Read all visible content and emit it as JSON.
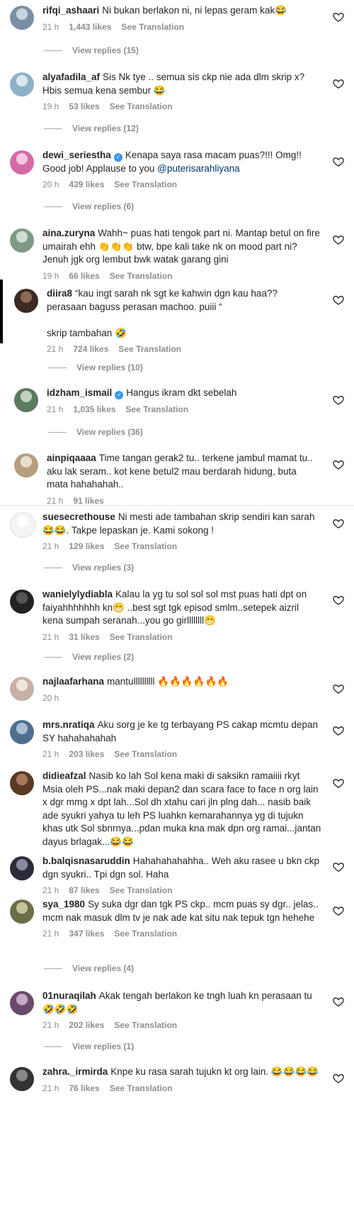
{
  "labels": {
    "see_translation": "See Translation"
  },
  "comments": [
    {
      "user": "rifqi_ashaari",
      "verified": false,
      "text": "Ni bukan berlakon ni, ni lepas geram kak😂",
      "time": "21 h",
      "likes": "1,443 likes",
      "translate": true,
      "replies": "View replies (15)",
      "avatar": [
        "#7a8fa6",
        "#c9d4de"
      ]
    },
    {
      "user": "alyafadila_af",
      "verified": false,
      "text": "Sis Nk tye .. semua sis ckp nie ada dlm skrip x? Hbis semua kena sembur 😂",
      "time": "19 h",
      "likes": "53 likes",
      "translate": true,
      "replies": "View replies (12)",
      "avatar": [
        "#8fb1c7",
        "#dbe6ee"
      ]
    },
    {
      "user": "dewi_seriestha",
      "verified": true,
      "text": "Kenapa saya rasa macam puas?!!! Omg!! Good job! Applause to you ",
      "mention": "@puterisarahliyana",
      "time": "20 h",
      "likes": "439 likes",
      "translate": true,
      "replies": "View replies (6)",
      "avatar": [
        "#d46aa6",
        "#f1c7df"
      ]
    },
    {
      "user": "aina.zuryna",
      "verified": false,
      "text": "Wahh~ puas hati tengok part ni. Mantap betul on fire umairah ehh 👏👏👏 btw, bpe kali take nk on mood part ni? Jenuh jgk org lembut bwk watak garang gini",
      "time": "19 h",
      "likes": "66 likes",
      "translate": true,
      "replies": "",
      "avatar": [
        "#7d9a86",
        "#cfdcd3"
      ]
    },
    {
      "user": "diira8",
      "verified": false,
      "text": "“kau ingt sarah nk sgt ke kahwin dgn kau haa?? perasaan baguss perasan machoo. puiii “\n\nskrip tambahan 🤣",
      "time": "21 h",
      "likes": "724 likes",
      "translate": true,
      "replies": "View replies (10)",
      "avatar": [
        "#3b2a22",
        "#8a6a55"
      ]
    },
    {
      "user": "idzham_ismail",
      "verified": true,
      "text": "Hangus ikram dkt sebelah",
      "time": "21 h",
      "likes": "1,035 likes",
      "translate": true,
      "replies": "View replies (36)",
      "avatar": [
        "#5b7a5e",
        "#c2d3c0"
      ]
    },
    {
      "user": "ainpiqaaaa",
      "verified": false,
      "text": "Time tangan gerak2 tu.. terkene jambul mamat tu.. aku lak seram.. kot kene betul2 mau berdarah hidung, buta mata hahahahah..",
      "time": "21 h",
      "likes": "91 likes",
      "translate": false,
      "replies": "",
      "avatar": [
        "#b79e7e",
        "#eadfcf"
      ]
    },
    {
      "user": "suesecrethouse",
      "verified": false,
      "text": "Ni mesti ade tambahan skrip sendiri kan sarah 😂😂. Takpe lepaskan je. Kami sokong !",
      "time": "21 h",
      "likes": "129 likes",
      "translate": true,
      "replies": "View replies (3)",
      "avatar": [
        "#f4f4f4",
        "#ffffff"
      ]
    },
    {
      "user": "wanielylydiabla",
      "verified": false,
      "text": "Kalau la yg tu sol sol sol mst puas hati dpt on faiyahhhhhhh kn😁 ..best sgt tgk episod smlm..setepek aizril kena sumpah seranah...you go girllllllll😁",
      "time": "21 h",
      "likes": "31 likes",
      "translate": true,
      "replies": "View replies (2)",
      "avatar": [
        "#222",
        "#555"
      ]
    },
    {
      "user": "najlaafarhana",
      "verified": false,
      "text": "mantullllllllll 🔥🔥🔥🔥🔥🔥",
      "time": "20 h",
      "likes": "",
      "translate": false,
      "replies": "",
      "avatar": [
        "#c7b0a6",
        "#efe4de"
      ]
    },
    {
      "user": "mrs.nratiqa",
      "verified": false,
      "text": "Aku sorg je ke tg terbayang PS cakap mcmtu depan SY hahahahahah",
      "time": "21 h",
      "likes": "203 likes",
      "translate": true,
      "replies": "",
      "avatar": [
        "#506e8c",
        "#a9bed3"
      ]
    },
    {
      "user": "didieafzal",
      "verified": false,
      "text": "Nasib ko lah Sol kena maki di saksikn ramaiiii rkyt Msia oleh PS...nak maki depan2 dan scara face to face n org lain x dgr mmg x dpt lah...Sol dh xtahu cari jln plng dah... nasib baik ade syukri yahya tu leh PS luahkn kemarahannya yg di tujukn khas utk Sol sbnrnya...pdan muka kna mak dpn org ramai...jantan dayus brlagak...😂😂",
      "time": "",
      "likes": "",
      "translate": false,
      "replies": "",
      "avatar": [
        "#5a3a25",
        "#a47a58"
      ]
    },
    {
      "user": "b.balqisnasaruddin",
      "verified": false,
      "text": "Hahahahahahha.. Weh aku rasee u bkn ckp dgn syukri.. Tpi dgn sol. Haha",
      "time": "21 h",
      "likes": "87 likes",
      "translate": true,
      "replies": "",
      "avatar": [
        "#2b2b3a",
        "#8a8aa2"
      ]
    },
    {
      "user": "sya_1980",
      "verified": false,
      "text": "Sy suka dgr dan tgk PS ckp.. mcm puas sy dgr.. jelas.. mcm nak masuk dlm tv je nak ade kat situ nak tepuk tgn hehehe",
      "time": "21 h",
      "likes": "347 likes",
      "translate": true,
      "replies": "View replies (4)",
      "avatar": [
        "#6d6d4a",
        "#c4c49c"
      ]
    },
    {
      "user": "01nuraqilah",
      "verified": false,
      "text": "Akak tengah berlakon ke tngh luah kn perasaan tu 🤣🤣🤣",
      "time": "21 h",
      "likes": "202 likes",
      "translate": true,
      "replies": "View replies (1)",
      "avatar": [
        "#6a4a6a",
        "#c8a8c8"
      ]
    },
    {
      "user": "zahra._irmirda",
      "verified": false,
      "text": "Knpe ku rasa sarah tujukn kt org lain. 😂😂😂😂",
      "time": "21 h",
      "likes": "76 likes",
      "translate": true,
      "replies": "",
      "avatar": [
        "#333",
        "#888"
      ]
    }
  ]
}
